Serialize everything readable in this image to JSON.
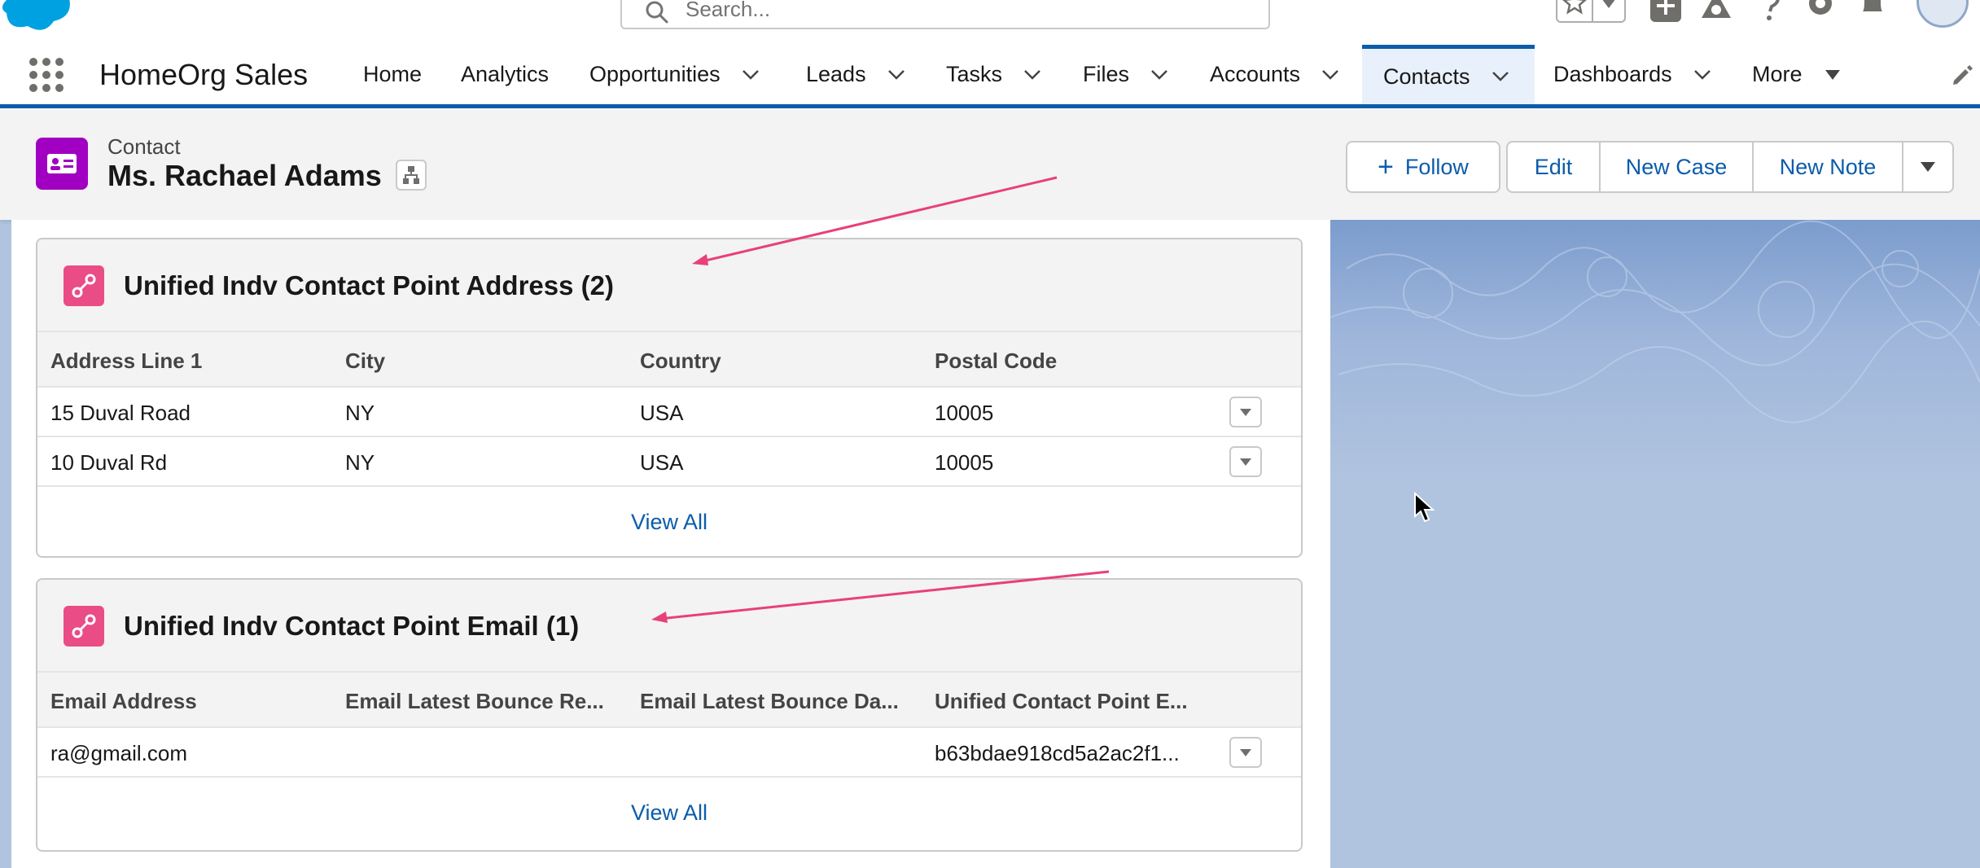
{
  "app": {
    "name": "HomeOrg Sales"
  },
  "search": {
    "placeholder": "Search..."
  },
  "nav": {
    "items": [
      {
        "label": "Home",
        "has_menu": false
      },
      {
        "label": "Analytics",
        "has_menu": false
      },
      {
        "label": "Opportunities",
        "has_menu": true
      },
      {
        "label": "Leads",
        "has_menu": true
      },
      {
        "label": "Tasks",
        "has_menu": true
      },
      {
        "label": "Files",
        "has_menu": true
      },
      {
        "label": "Accounts",
        "has_menu": true
      },
      {
        "label": "Contacts",
        "has_menu": true,
        "active": true
      },
      {
        "label": "Dashboards",
        "has_menu": true
      },
      {
        "label": "More",
        "has_menu": true
      }
    ]
  },
  "record": {
    "type_label": "Contact",
    "name": "Ms. Rachael Adams",
    "icon": "contact-card-icon"
  },
  "actions": {
    "follow": "Follow",
    "edit": "Edit",
    "new_case": "New Case",
    "new_note": "New Note"
  },
  "address_card": {
    "title": "Unified Indv Contact Point Address (2)",
    "icon": "contact-point-icon",
    "columns": [
      "Address Line 1",
      "City",
      "Country",
      "Postal Code"
    ],
    "rows": [
      [
        "15 Duval Road",
        "NY",
        "USA",
        "10005"
      ],
      [
        "10 Duval Rd",
        "NY",
        "USA",
        "10005"
      ]
    ],
    "view_all": "View All"
  },
  "email_card": {
    "title": "Unified Indv Contact Point Email (1)",
    "icon": "contact-point-icon",
    "columns": [
      "Email Address",
      "Email Latest Bounce Re...",
      "Email Latest Bounce Da...",
      "Unified Contact Point E..."
    ],
    "rows": [
      [
        "ra@gmail.com",
        "",
        "",
        "b63bdae918cd5a2ac2f1..."
      ]
    ],
    "view_all": "View All"
  },
  "colors": {
    "brand_blue": "#0b5cab",
    "contact_icon": "#a100c2",
    "card_icon": "#ea4c86",
    "annotation_arrow": "#e8407a"
  }
}
